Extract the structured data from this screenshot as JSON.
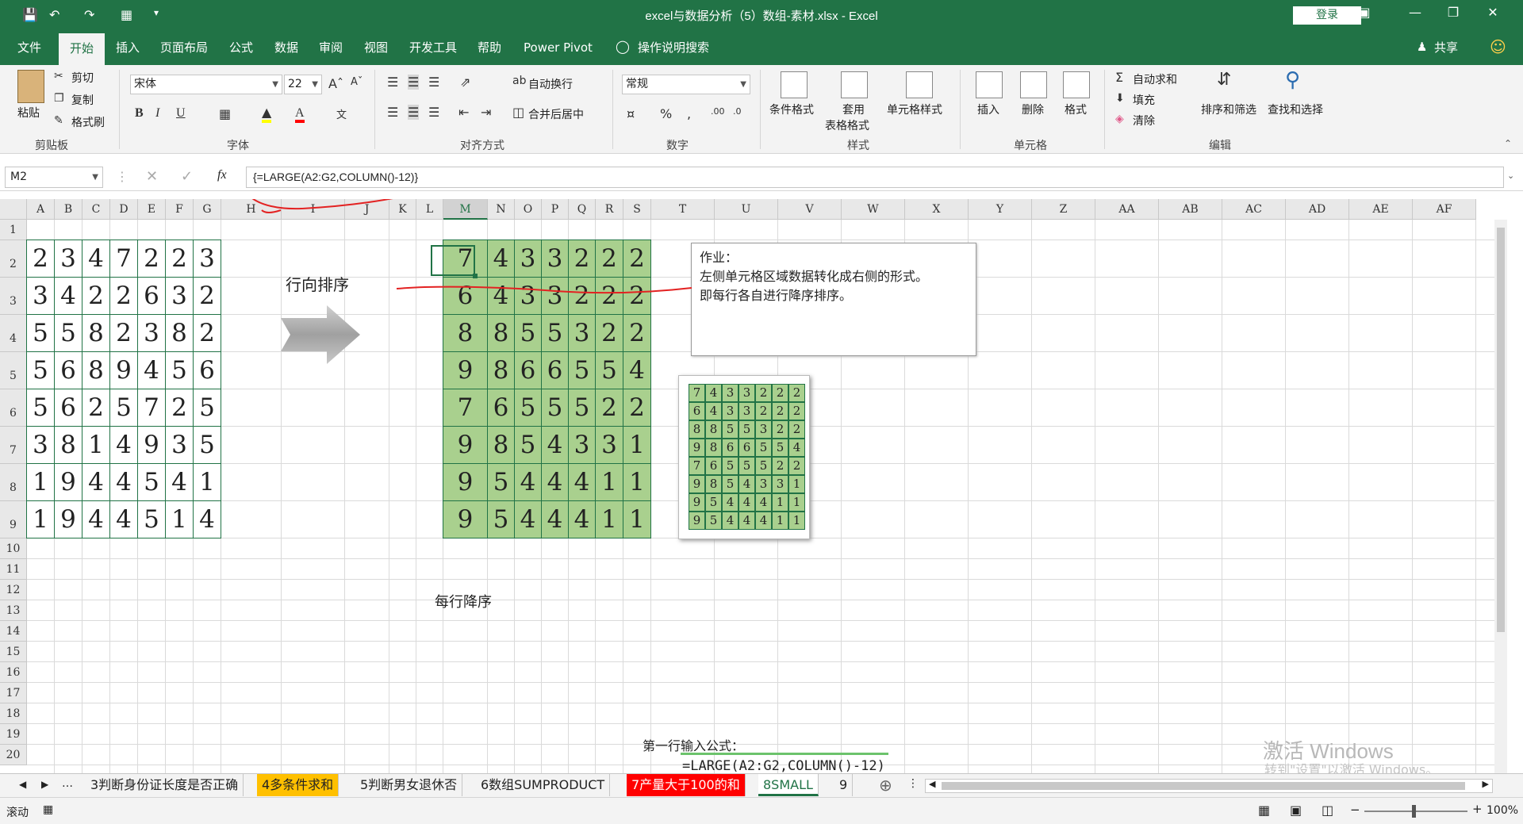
{
  "title_bar": {
    "title": "excel与数据分析（5）数组-素材.xlsx  -  Excel",
    "login_label": "登录",
    "save_icon": "save-icon",
    "undo_icon": "undo-icon",
    "redo_icon": "redo-icon"
  },
  "ribbon_tabs": [
    "文件",
    "开始",
    "插入",
    "页面布局",
    "公式",
    "数据",
    "审阅",
    "视图",
    "开发工具",
    "帮助",
    "Power Pivot"
  ],
  "tell_me": "操作说明搜索",
  "share_label": "共享",
  "ribbon": {
    "clipboard": {
      "paste": "粘贴",
      "cut": "剪切",
      "copy": "复制",
      "format_painter": "格式刷",
      "label": "剪贴板"
    },
    "font": {
      "name": "宋体",
      "size": "22",
      "bold": "B",
      "italic": "I",
      "underline": "U",
      "label": "字体"
    },
    "alignment": {
      "wrap": "自动换行",
      "merge": "合并后居中",
      "label": "对齐方式"
    },
    "number": {
      "format": "常规",
      "label": "数字"
    },
    "styles": {
      "conditional": "条件格式",
      "table_line1": "套用",
      "table_line2": "表格格式",
      "cell_styles": "单元格样式",
      "label": "样式"
    },
    "cells": {
      "insert": "插入",
      "delete": "删除",
      "format": "格式",
      "label": "单元格"
    },
    "editing": {
      "autosum": "自动求和",
      "fill": "填充",
      "clear": "清除",
      "sort": "排序和筛选",
      "find": "查找和选择",
      "label": "编辑"
    }
  },
  "formula_bar": {
    "name_box": "M2",
    "fx": "fx",
    "formula": "{=LARGE(A2:G2,COLUMN()-12)}"
  },
  "grid": {
    "columns": [
      "A",
      "B",
      "C",
      "D",
      "E",
      "F",
      "G",
      "H",
      "I",
      "J",
      "K",
      "L",
      "M",
      "N",
      "O",
      "P",
      "Q",
      "R",
      "S",
      "T",
      "U",
      "V",
      "W",
      "X",
      "Y",
      "Z",
      "AA",
      "AB",
      "AC",
      "AD",
      "AE",
      "AF"
    ],
    "selected_column": "M",
    "rows": [
      "1",
      "2",
      "3",
      "4",
      "5",
      "6",
      "7",
      "8",
      "9",
      "10",
      "11",
      "12",
      "13",
      "14",
      "15",
      "16",
      "17",
      "18",
      "19",
      "20"
    ],
    "source": [
      [
        "2",
        "3",
        "4",
        "7",
        "2",
        "2",
        "3"
      ],
      [
        "3",
        "4",
        "2",
        "2",
        "6",
        "3",
        "2"
      ],
      [
        "5",
        "5",
        "8",
        "2",
        "3",
        "8",
        "2"
      ],
      [
        "5",
        "6",
        "8",
        "9",
        "4",
        "5",
        "6"
      ],
      [
        "5",
        "6",
        "2",
        "5",
        "7",
        "2",
        "5"
      ],
      [
        "3",
        "8",
        "1",
        "4",
        "9",
        "3",
        "5"
      ],
      [
        "1",
        "9",
        "4",
        "4",
        "5",
        "4",
        "1"
      ],
      [
        "1",
        "9",
        "4",
        "4",
        "5",
        "1",
        "4"
      ]
    ],
    "sorted": [
      [
        "7",
        "4",
        "3",
        "3",
        "2",
        "2",
        "2"
      ],
      [
        "6",
        "4",
        "3",
        "3",
        "2",
        "2",
        "2"
      ],
      [
        "8",
        "8",
        "5",
        "5",
        "3",
        "2",
        "2"
      ],
      [
        "9",
        "8",
        "6",
        "6",
        "5",
        "5",
        "4"
      ],
      [
        "7",
        "6",
        "5",
        "5",
        "5",
        "2",
        "2"
      ],
      [
        "9",
        "8",
        "5",
        "4",
        "3",
        "3",
        "1"
      ],
      [
        "9",
        "5",
        "4",
        "4",
        "4",
        "1",
        "1"
      ],
      [
        "9",
        "5",
        "4",
        "4",
        "4",
        "1",
        "1"
      ]
    ],
    "arrow_label": "行向排序",
    "note_title": "作业：",
    "note_line1": "左侧单元格区域数据转化成右侧的形式。",
    "note_line2": "即每行各自进行降序排序。",
    "desc_label": "每行降序",
    "formula_note_label": "第一行输入公式：",
    "formula_note_value": "=LARGE(A2:G2,COLUMN()-12)"
  },
  "sheet_tabs": [
    {
      "name": "3判断身份证长度是否正确",
      "style": "normal"
    },
    {
      "name": "4多条件求和",
      "style": "yellow"
    },
    {
      "name": "5判断男女退休否",
      "style": "normal"
    },
    {
      "name": "6数组SUMPRODUCT",
      "style": "normal"
    },
    {
      "name": "7产量大于100的和",
      "style": "red"
    },
    {
      "name": "8SMALL",
      "style": "active"
    },
    {
      "name": "9",
      "style": "normal"
    }
  ],
  "status": {
    "mode": "滚动",
    "zoom": "100%"
  },
  "watermark": {
    "line1": "激活 Windows",
    "line2": "转到\"设置\"以激活 Windows。"
  },
  "colors": {
    "excel_green": "#217346",
    "sorted_fill": "#a9d08e",
    "annotation_red": "#e32222"
  }
}
